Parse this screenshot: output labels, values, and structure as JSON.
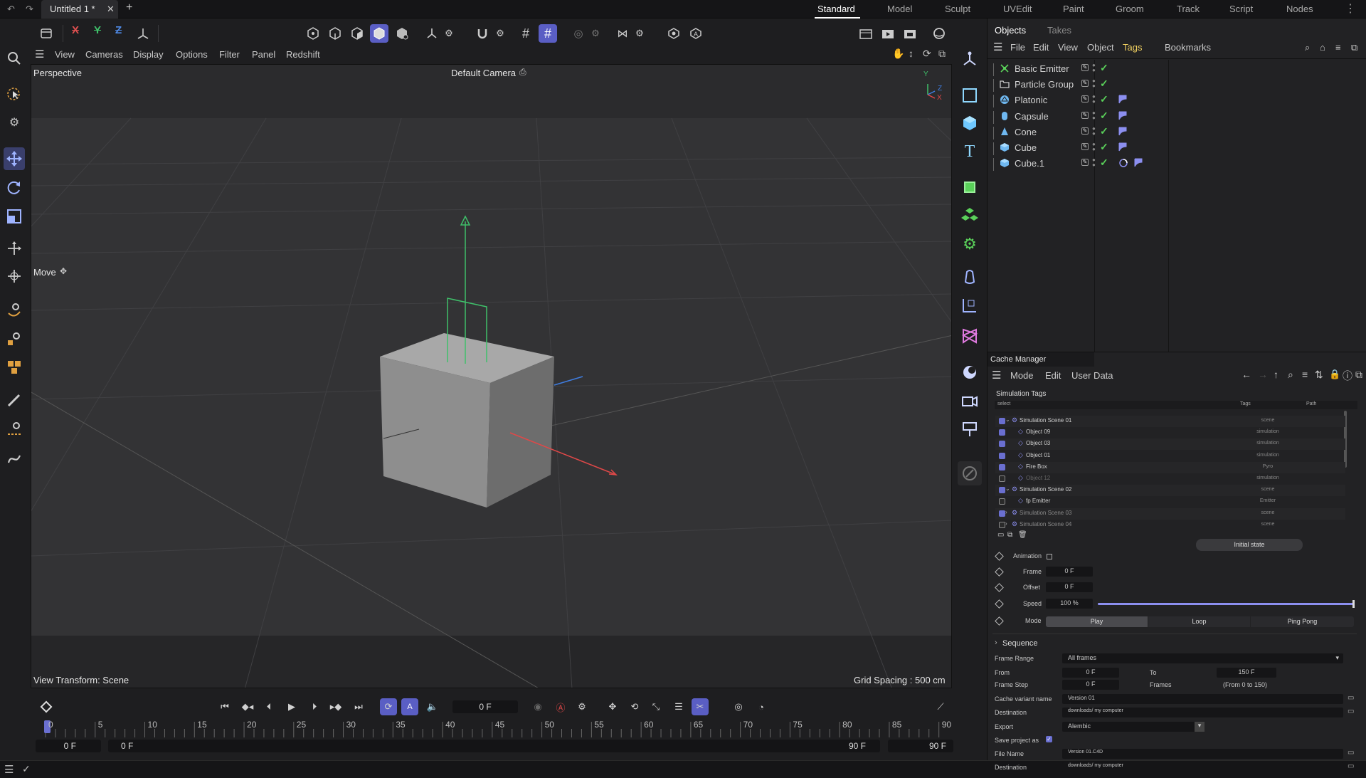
{
  "app": {
    "doc_tab": "Untitled 1 *",
    "layouts": [
      "Standard",
      "Model",
      "Sculpt",
      "UVEdit",
      "Paint",
      "Groom",
      "Track",
      "Script",
      "Nodes"
    ],
    "active_layout": "Standard"
  },
  "axis_toggles": {
    "x": "X",
    "y": "Y",
    "z": "Z"
  },
  "viewport": {
    "menu": [
      "View",
      "Cameras",
      "Display",
      "Options",
      "Filter",
      "Panel",
      "Redshift"
    ],
    "view_name": "Perspective",
    "camera": "Default Camera",
    "tool": "Move",
    "view_transform": "View Transform: Scene",
    "grid_spacing": "Grid Spacing : 500 cm",
    "axis_labels": {
      "y": "Y",
      "z": "Z",
      "x": "X"
    }
  },
  "timeline": {
    "current_frame": "0 F",
    "ticks": [
      "0",
      "5",
      "10",
      "15",
      "20",
      "25",
      "30",
      "35",
      "40",
      "45",
      "50",
      "55",
      "60",
      "65",
      "70",
      "75",
      "80",
      "85",
      "90"
    ],
    "start_min": "0 F",
    "start": "0 F",
    "end": "90 F",
    "end_max": "90 F"
  },
  "objects_panel": {
    "tabs": [
      "Objects",
      "Takes"
    ],
    "menu": [
      "File",
      "Edit",
      "View",
      "Object",
      "Tags",
      "Bookmarks"
    ],
    "active_menu": "Tags",
    "items": [
      {
        "name": "Basic Emitter",
        "icon": "emitter-icon"
      },
      {
        "name": "Particle Group",
        "icon": "folder-icon"
      },
      {
        "name": "Platonic",
        "icon": "platonic-icon"
      },
      {
        "name": "Capsule",
        "icon": "capsule-icon"
      },
      {
        "name": "Cone",
        "icon": "cone-icon"
      },
      {
        "name": "Cube",
        "icon": "cube-icon"
      },
      {
        "name": "Cube.1",
        "icon": "cube-icon"
      }
    ]
  },
  "cache_manager": {
    "title": "Cache Manager",
    "menu": [
      "Mode",
      "Edit",
      "User Data"
    ],
    "section": "Simulation Tags",
    "columns": {
      "select": "select",
      "tags": "Tags",
      "path": "Path"
    },
    "tree": [
      {
        "name": "Simulation Scene 01",
        "tag": "scene",
        "checked": true,
        "level": 0
      },
      {
        "name": "Object 09",
        "tag": "simulation",
        "checked": true,
        "level": 1
      },
      {
        "name": "Object 03",
        "tag": "simulation",
        "checked": true,
        "level": 1
      },
      {
        "name": "Object 01",
        "tag": "simulation",
        "checked": true,
        "level": 1
      },
      {
        "name": "Fire Box",
        "tag": "Pyro",
        "checked": true,
        "level": 1
      },
      {
        "name": "Object 12",
        "tag": "simulation",
        "checked": false,
        "level": 1
      },
      {
        "name": "Simulation Scene 02",
        "tag": "scene",
        "checked": true,
        "level": 0
      },
      {
        "name": "fp Emitter",
        "tag": "Emitter",
        "checked": false,
        "level": 1
      },
      {
        "name": "Simulation Scene 03",
        "tag": "scene",
        "checked": true,
        "level": 0
      },
      {
        "name": "Simulation Scene 04",
        "tag": "scene",
        "checked": false,
        "level": 0
      }
    ],
    "initial_state": "Initial state",
    "animation_label": "Animation",
    "frame_label": "Frame",
    "frame_value": "0 F",
    "offset_label": "Offset",
    "offset_value": "0 F",
    "speed_label": "Speed",
    "speed_value": "100 %",
    "speed_fraction": 1.0,
    "mode_label": "Mode",
    "mode_options": [
      "Play",
      "Loop",
      "Ping Pong"
    ],
    "mode_selected": "Play",
    "sequence_label": "Sequence",
    "frame_range_label": "Frame Range",
    "frame_range_value": "All frames",
    "from_label": "From",
    "from_value": "0 F",
    "to_label": "To",
    "to_value": "150 F",
    "frame_step_label": "Frame Step",
    "frame_step_value": "0 F",
    "frames_label": "Frames",
    "frames_info": "(From 0 to 150)",
    "cache_variant_label": "Cache variant name",
    "cache_variant_value": "Version 01",
    "destination_label": "Destination",
    "destination_value": "downloads/ my computer",
    "export_label": "Export",
    "export_value": "Alembic",
    "save_project_label": "Save project as",
    "file_name_label": "File Name",
    "file_name_value": "Version 01.C4D",
    "destination2_label": "Destination",
    "destination2_value": "downloads/ my computer"
  },
  "colors": {
    "accent": "#5a5ec4",
    "check": "#5ad15a",
    "axis_x": "#e04848",
    "axis_y": "#3fc06a",
    "axis_z": "#3f7de0"
  }
}
